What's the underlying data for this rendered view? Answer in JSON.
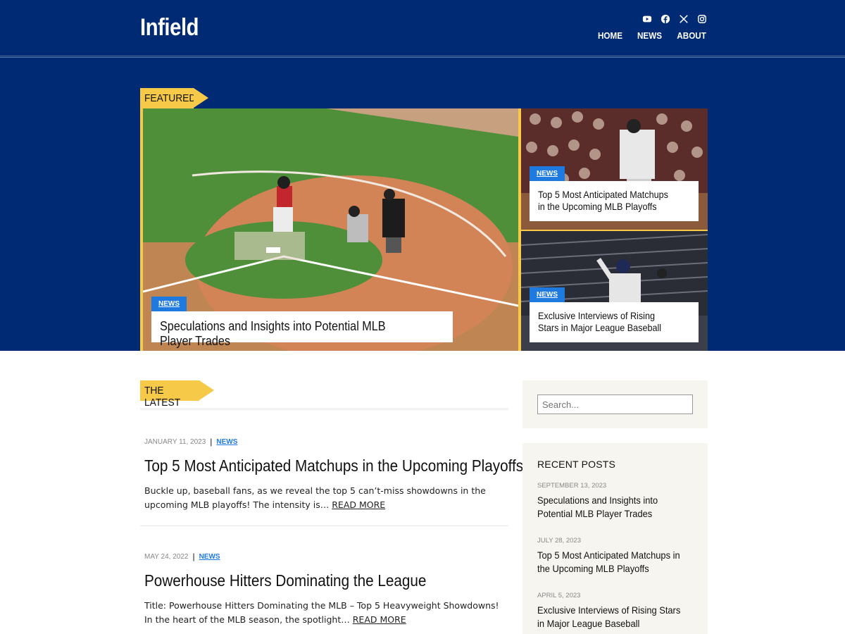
{
  "site": {
    "title": "Infield"
  },
  "socials": [
    {
      "icon": "youtube-icon"
    },
    {
      "icon": "facebook-icon"
    },
    {
      "icon": "x-twitter-icon"
    },
    {
      "icon": "instagram-icon"
    }
  ],
  "nav": [
    {
      "label": "HOME"
    },
    {
      "label": "NEWS"
    },
    {
      "label": "ABOUT"
    }
  ],
  "featured": {
    "label": "FEATURED",
    "main": {
      "category": "NEWS",
      "title": "Speculations and Insights into Potential MLB Player Trades"
    },
    "side": [
      {
        "category": "NEWS",
        "title": "Top 5 Most Anticipated Matchups in the Upcoming MLB Playoffs"
      },
      {
        "category": "NEWS",
        "title": "Exclusive Interviews of Rising Stars in Major League Baseball"
      }
    ]
  },
  "latest": {
    "label": "THE LATEST",
    "posts": [
      {
        "date": "JANUARY 11, 2023",
        "category": "NEWS",
        "title": "Top 5 Most Anticipated Matchups in the Upcoming Playoffs",
        "excerpt": "Buckle up, baseball fans, as we reveal the top 5 can’t-miss showdowns in the upcoming MLB playoffs! The intensity is…",
        "more": "READ MORE"
      },
      {
        "date": "MAY 24, 2022",
        "category": "NEWS",
        "title": "Powerhouse Hitters Dominating the League",
        "excerpt": "Title: Powerhouse Hitters Dominating the MLB – Top 5 Heavyweight Showdowns! In the heart of the MLB season, the spotlight…",
        "more": "READ MORE"
      }
    ]
  },
  "sidebar": {
    "search_placeholder": "Search...",
    "recent_title": "RECENT POSTS",
    "recent": [
      {
        "date": "SEPTEMBER 13, 2023",
        "title": "Speculations and Insights into Potential MLB Player Trades"
      },
      {
        "date": "JULY 28, 2023",
        "title": "Top 5 Most Anticipated Matchups in the Upcoming MLB Playoffs"
      },
      {
        "date": "APRIL 5, 2023",
        "title": "Exclusive Interviews of Rising Stars in Major League Baseball"
      }
    ]
  },
  "colors": {
    "navy": "#002a73",
    "accent": "#f7c948",
    "link": "#1f7ae0"
  }
}
